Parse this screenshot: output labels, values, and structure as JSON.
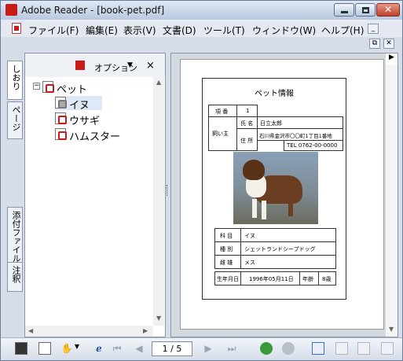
{
  "window": {
    "title": "Adobe Reader - [book-pet.pdf]"
  },
  "menu": [
    "ファイル(F)",
    "編集(E)",
    "表示(V)",
    "文書(D)",
    "ツール(T)",
    "ウィンドウ(W)",
    "ヘルプ(H)"
  ],
  "sidebar_tabs": [
    "しおり",
    "ページ",
    "添付ファイル",
    "注釈"
  ],
  "nav_panel": {
    "options_label": "オプション",
    "close_glyph": "×",
    "tree": {
      "root": "ペット",
      "children": [
        "イヌ",
        "ウサギ",
        "ハムスター"
      ]
    }
  },
  "document": {
    "title": "ペット情報",
    "item_label": "項 番",
    "item_value": "1",
    "owner_label": "飼い主",
    "name_label": "氏 名",
    "name_value": "日立太郎",
    "address_label": "住 所",
    "address_value": "石川県金沢市〇〇町1丁目1番地",
    "tel_value": "TEL 0762-00-0000",
    "rows": [
      {
        "label": "科 目",
        "value": "イヌ"
      },
      {
        "label": "種 別",
        "value": "シェットランドシープドッグ"
      },
      {
        "label": "雌 雄",
        "value": "メス"
      }
    ],
    "birth_label": "生年月日",
    "birth_value": "1996年05月11日",
    "age_label": "年齢",
    "age_value": "8歳"
  },
  "toolbar": {
    "page_indicator": "1 / 5"
  },
  "colors": {
    "accent": "#c81a16",
    "chrome": "#d6dde9"
  }
}
